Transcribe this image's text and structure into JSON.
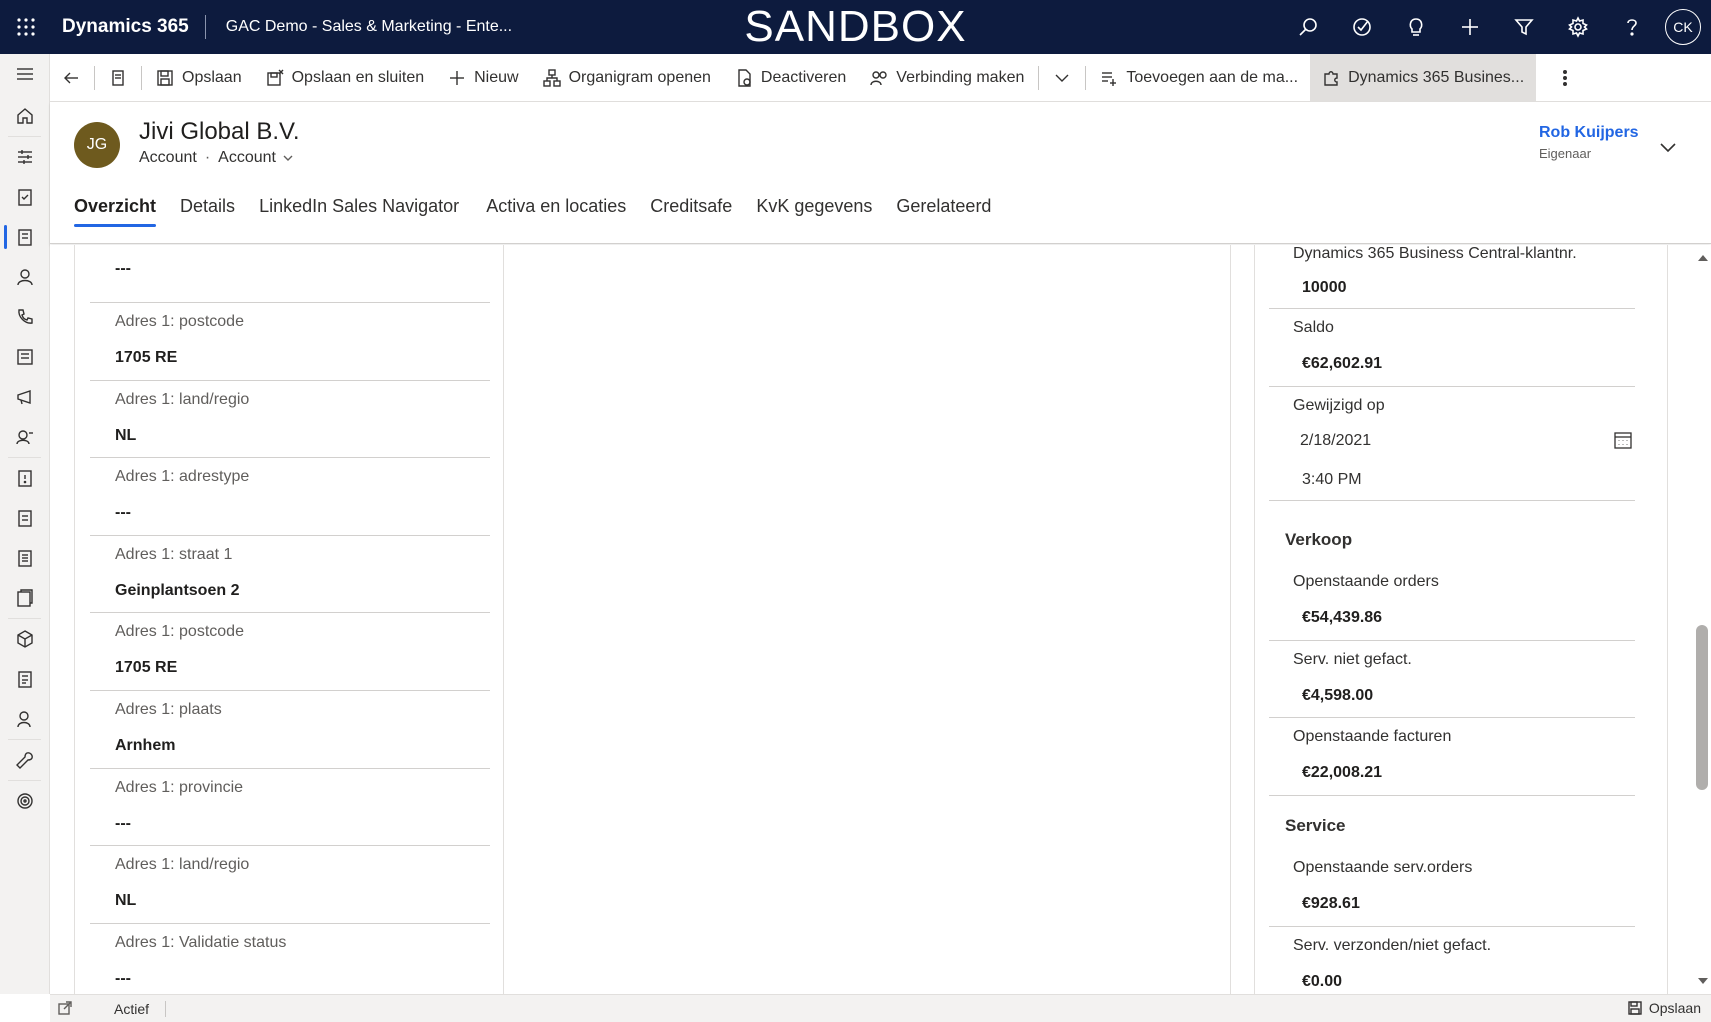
{
  "topbar": {
    "app_name": "Dynamics 365",
    "env_name": "GAC Demo - Sales & Marketing - Ente...",
    "banner": "SANDBOX",
    "user_initials": "CK"
  },
  "commands": {
    "save": "Opslaan",
    "save_close": "Opslaan en sluiten",
    "new": "Nieuw",
    "org_chart": "Organigram openen",
    "deactivate": "Deactiveren",
    "connect": "Verbinding maken",
    "add_to_list": "Toevoegen aan de ma...",
    "bc": "Dynamics 365 Busines..."
  },
  "record": {
    "initials": "JG",
    "title": "Jivi Global B.V.",
    "entity": "Account",
    "form": "Account",
    "owner_name": "Rob Kuijpers",
    "owner_label": "Eigenaar"
  },
  "tabs": [
    "Overzicht",
    "Details",
    "LinkedIn Sales Navigator",
    "Activa en locaties",
    "Creditsafe",
    "KvK gegevens",
    "Gerelateerd"
  ],
  "left_fields": [
    {
      "label": "",
      "value": "---"
    },
    {
      "label": "Adres 1: postcode",
      "value": "1705 RE"
    },
    {
      "label": "Adres 1: land/regio",
      "value": "NL"
    },
    {
      "label": "Adres 1: adrestype",
      "value": "---"
    },
    {
      "label": "Adres 1: straat 1",
      "value": "Geinplantsoen 2"
    },
    {
      "label": "Adres 1: postcode",
      "value": "1705 RE"
    },
    {
      "label": "Adres 1: plaats",
      "value": "Arnhem"
    },
    {
      "label": "Adres 1: provincie",
      "value": "---"
    },
    {
      "label": "Adres 1: land/regio",
      "value": "NL"
    },
    {
      "label": "Adres 1: Validatie status",
      "value": "---"
    }
  ],
  "right": {
    "bc_customer_label": "Dynamics 365 Business Central-klantnr.",
    "bc_customer_value": "10000",
    "balance_label": "Saldo",
    "balance_value": "€62,602.91",
    "modified_label": "Gewijzigd op",
    "modified_date": "2/18/2021",
    "modified_time": "3:40 PM",
    "sales_section": "Verkoop",
    "open_orders_label": "Openstaande orders",
    "open_orders_value": "€54,439.86",
    "serv_not_invoiced_label": "Serv. niet gefact.",
    "serv_not_invoiced_value": "€4,598.00",
    "open_invoices_label": "Openstaande facturen",
    "open_invoices_value": "€22,008.21",
    "service_section": "Service",
    "open_serv_orders_label": "Openstaande serv.orders",
    "open_serv_orders_value": "€928.61",
    "serv_shipped_label": "Serv. verzonden/niet gefact.",
    "serv_shipped_value": "€0.00"
  },
  "statusbar": {
    "status": "Actief",
    "save": "Opslaan"
  },
  "colors": {
    "topbar": "#0d1b3e",
    "accent": "#2266e3",
    "avatar": "#6e5a1e"
  }
}
